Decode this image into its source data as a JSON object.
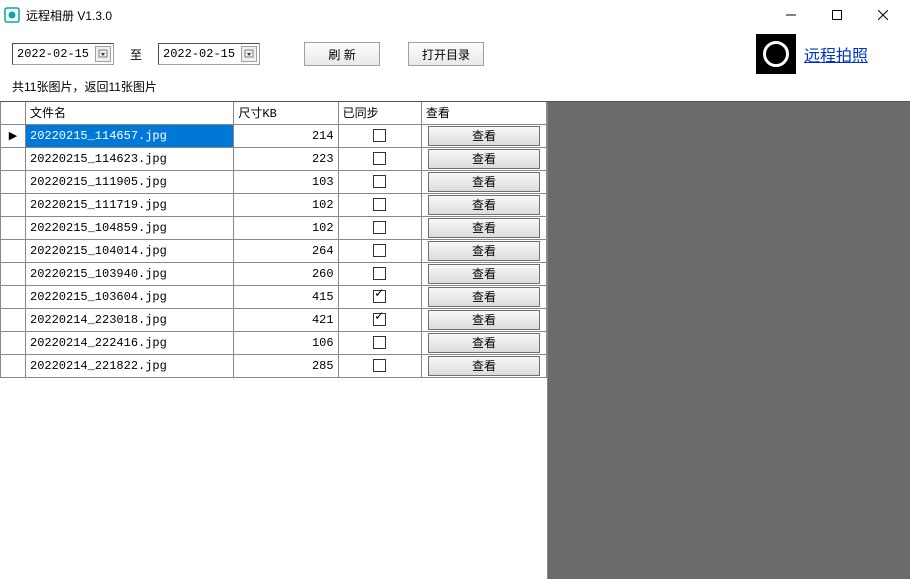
{
  "window": {
    "title": "远程相册 V1.3.0"
  },
  "toolbar": {
    "date_from": "2022-02-15",
    "to_label": "至",
    "date_to": "2022-02-15",
    "refresh_label": "刷 新",
    "open_dir_label": "打开目录",
    "remote_photo_label": "远程拍照"
  },
  "status": "共11张图片，返回11张图片",
  "table": {
    "headers": {
      "filename": "文件名",
      "size": "尺寸KB",
      "synced": "已同步",
      "view": "查看"
    },
    "view_button_label": "查看",
    "rows": [
      {
        "filename": "20220215_114657.jpg",
        "size": "214",
        "synced": false,
        "selected": true
      },
      {
        "filename": "20220215_114623.jpg",
        "size": "223",
        "synced": false,
        "selected": false
      },
      {
        "filename": "20220215_111905.jpg",
        "size": "103",
        "synced": false,
        "selected": false
      },
      {
        "filename": "20220215_111719.jpg",
        "size": "102",
        "synced": false,
        "selected": false
      },
      {
        "filename": "20220215_104859.jpg",
        "size": "102",
        "synced": false,
        "selected": false
      },
      {
        "filename": "20220215_104014.jpg",
        "size": "264",
        "synced": false,
        "selected": false
      },
      {
        "filename": "20220215_103940.jpg",
        "size": "260",
        "synced": false,
        "selected": false
      },
      {
        "filename": "20220215_103604.jpg",
        "size": "415",
        "synced": true,
        "selected": false
      },
      {
        "filename": "20220214_223018.jpg",
        "size": "421",
        "synced": true,
        "selected": false
      },
      {
        "filename": "20220214_222416.jpg",
        "size": "106",
        "synced": false,
        "selected": false
      },
      {
        "filename": "20220214_221822.jpg",
        "size": "285",
        "synced": false,
        "selected": false
      }
    ]
  }
}
